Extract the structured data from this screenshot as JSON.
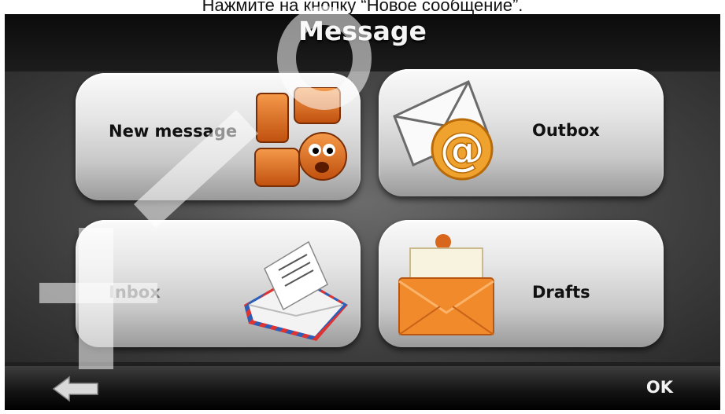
{
  "caption": "Нажмите на кнопку “Новое сообщение”.",
  "screen": {
    "title": "Message",
    "tiles": [
      {
        "label": "New message",
        "icon": "im-chat-icon"
      },
      {
        "label": "Outbox",
        "icon": "envelope-at-icon"
      },
      {
        "label": "Inbox",
        "icon": "airmail-letter-icon"
      },
      {
        "label": "Drafts",
        "icon": "orange-envelope-icon"
      }
    ],
    "bottom": {
      "back_icon": "back-arrow-icon",
      "ok_label": "OK"
    }
  },
  "colors": {
    "title_text": "#f4f4f4",
    "tile_label": "#111111",
    "inbox_label": "#6f6f6f",
    "icon_orange": "#e8791f"
  }
}
